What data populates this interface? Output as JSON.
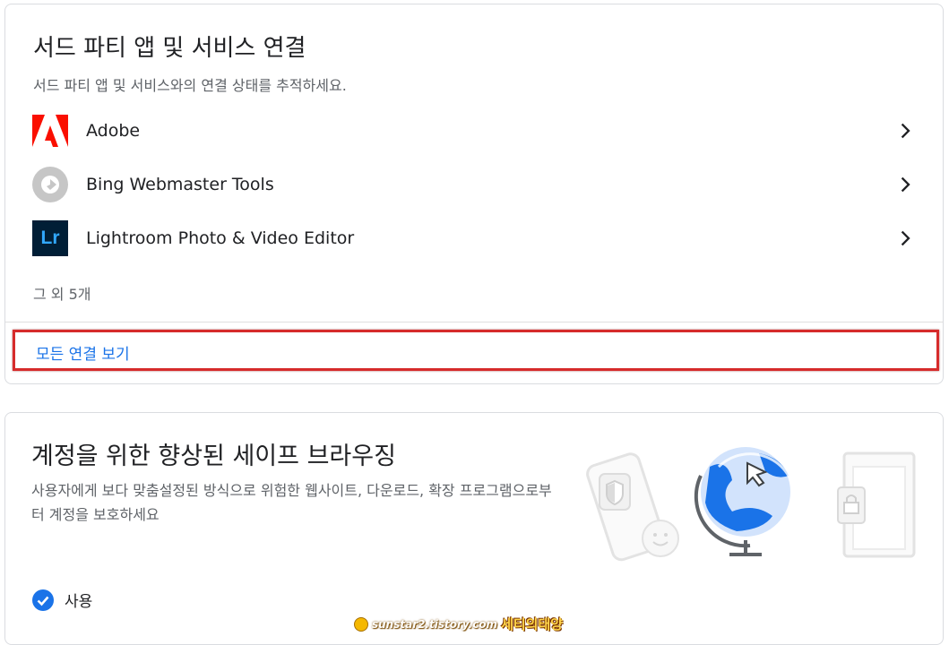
{
  "connections_card": {
    "title": "서드 파티 앱 및 서비스 연결",
    "subtitle": "서드 파티 앱 및 서비스와의 연결 상태를 추적하세요.",
    "items": [
      {
        "label": "Adobe",
        "icon": "adobe-logo"
      },
      {
        "label": "Bing Webmaster Tools",
        "icon": "bing-webmaster-logo"
      },
      {
        "label": "Lightroom Photo & Video Editor",
        "icon": "lightroom-logo",
        "icon_text": "Lr"
      }
    ],
    "more_text": "그 외 5개",
    "view_all_link": "모든 연결 보기"
  },
  "safe_browsing_card": {
    "title": "계정을 위한 향상된 세이프 브라우징",
    "description": "사용자에게 보다 맞춤설정된 방식으로 위험한 웹사이트, 다운로드, 확장 프로그램으로부터 계정을 보호하세요",
    "status_label": "사용"
  },
  "watermark": {
    "site": "sunstar2.tistory.com",
    "name": "세티의태양"
  },
  "colors": {
    "link": "#1a73e8",
    "highlight_border": "#d62b2b",
    "check": "#1a73e8",
    "adobe_red": "#fa0f00",
    "lightroom_bg": "#001e36",
    "lightroom_text": "#31a8ff"
  }
}
